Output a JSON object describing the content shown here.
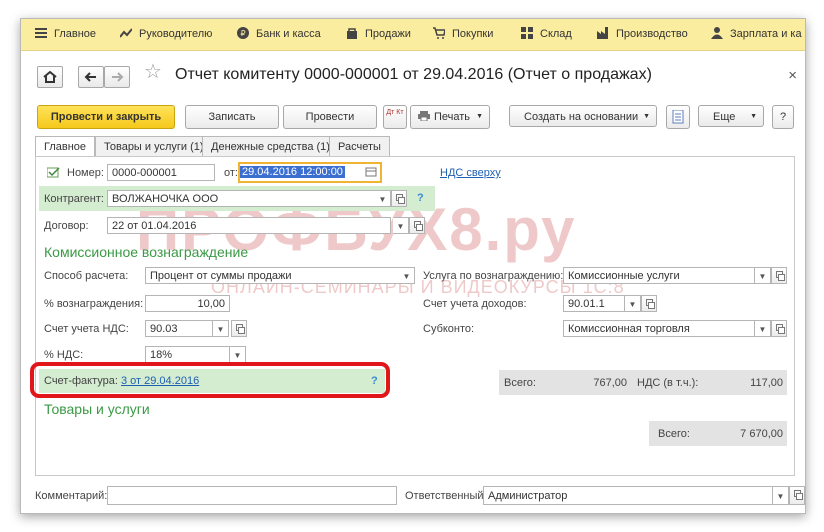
{
  "menu": {
    "items": [
      {
        "label": "Главное",
        "icon": "hamburger-icon"
      },
      {
        "label": "Руководителю",
        "icon": "trend-icon"
      },
      {
        "label": "Банк и касса",
        "icon": "coin-icon"
      },
      {
        "label": "Продажи",
        "icon": "shopping-bag-icon"
      },
      {
        "label": "Покупки",
        "icon": "cart-icon"
      },
      {
        "label": "Склад",
        "icon": "grid-icon"
      },
      {
        "label": "Производство",
        "icon": "factory-icon"
      },
      {
        "label": "Зарплата и ка",
        "icon": "person-icon"
      }
    ]
  },
  "document": {
    "title": "Отчет комитенту 0000-000001 от 29.04.2016 (Отчет о продажах)",
    "close_glyph": "×"
  },
  "toolbar": {
    "post_close_label": "Провести и закрыть",
    "save_label": "Записать",
    "post_label": "Провести",
    "dt_kt_label": "Дт Кт",
    "print_label": "Печать",
    "create_based_label": "Создать на основании",
    "more_label": "Еще",
    "help_label": "?"
  },
  "tabs": [
    {
      "label": "Главное"
    },
    {
      "label": "Товары и услуги (1)"
    },
    {
      "label": "Денежные средства (1)"
    },
    {
      "label": "Расчеты"
    }
  ],
  "form": {
    "number_label": "Номер:",
    "number_value": "0000-000001",
    "date_label": "от:",
    "date_value": "29.04.2016 12:00:00",
    "vat_link": "НДС сверху",
    "contractor_label": "Контрагент:",
    "contractor_value": "ВОЛЖАНОЧКА ООО",
    "contract_label": "Договор:",
    "contract_value": "22 от 01.04.2016",
    "commission_section": "Комиссионное вознаграждение",
    "calc_method_label": "Способ расчета:",
    "calc_method_value": "Процент от суммы продажи",
    "reward_percent_label": "% вознаграждения:",
    "reward_percent_value": "10,00",
    "vat_account_label": "Счет учета НДС:",
    "vat_account_value": "90.03",
    "vat_percent_label": "% НДС:",
    "vat_percent_value": "18%",
    "service_label": "Услуга по вознаграждению:",
    "service_value": "Комиссионные услуги",
    "income_account_label": "Счет учета доходов:",
    "income_account_value": "90.01.1",
    "subconto_label": "Субконто:",
    "subconto_value": "Комиссионная торговля",
    "invoice_label": "Счет-фактура:",
    "invoice_link": "3 от 29.04.2016",
    "total_label": "Всего:",
    "total_value": "767,00",
    "vat_incl_label": "НДС (в т.ч.):",
    "vat_incl_value": "117,00",
    "goods_section": "Товары и услуги",
    "goods_total_label": "Всего:",
    "goods_total_value": "7 670,00",
    "comment_label": "Комментарий:",
    "comment_value": "",
    "responsible_label": "Ответственный:",
    "responsible_value": "Администратор"
  },
  "watermark": {
    "main": "ПРОФБУХ8.ру",
    "sub": "ОНЛАЙН-СЕМИНАРЫ И ВИДЕОКУРСЫ 1С:8"
  },
  "colors": {
    "menubar": "#fbeda0",
    "primary_button": "#f5c81b",
    "section_green": "#3a9a45",
    "highlight_red": "#e0161b",
    "link_blue": "#1f5fb2"
  }
}
